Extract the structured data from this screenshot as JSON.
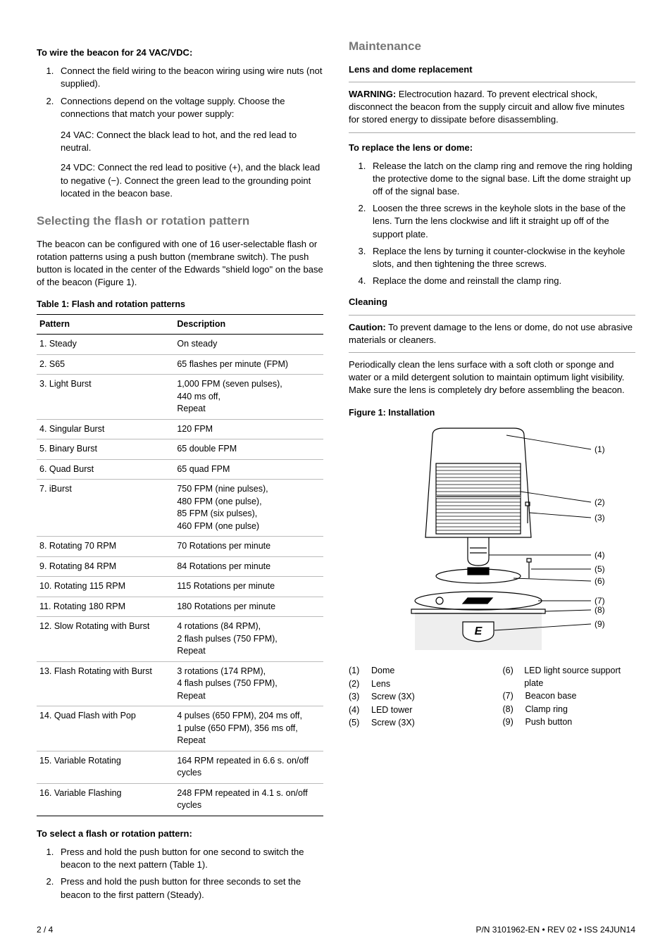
{
  "left": {
    "wire_heading": "To wire the beacon for 24 VAC/VDC:",
    "wire_steps": [
      "Connect the field wiring to the beacon wiring using wire nuts (not supplied).",
      "Connections depend on the voltage supply. Choose the connections that match your power supply:"
    ],
    "wire_sub1": "24 VAC: Connect the black lead to hot, and the red lead to neutral.",
    "wire_sub2": "24 VDC: Connect the red lead to positive (+), and the black lead to negative (−). Connect the green lead to the grounding point located in the beacon base.",
    "select_heading": "Selecting the flash or rotation pattern",
    "select_para": "The beacon can be configured with one of 16 user-selectable flash or rotation patterns using a push button (membrane switch). The push button is located in the center of the Edwards \"shield logo\" on the base of the beacon (Figure 1).",
    "table_caption": "Table 1: Flash and rotation patterns",
    "table_h1": "Pattern",
    "table_h2": "Description",
    "table_rows": [
      {
        "p": "1. Steady",
        "d": "On steady"
      },
      {
        "p": "2. S65",
        "d": "65 flashes per minute (FPM)"
      },
      {
        "p": "3. Light Burst",
        "d": "1,000 FPM (seven pulses),\n440 ms off,\nRepeat"
      },
      {
        "p": "4. Singular Burst",
        "d": "120 FPM"
      },
      {
        "p": "5. Binary Burst",
        "d": "65 double FPM"
      },
      {
        "p": "6. Quad Burst",
        "d": "65 quad FPM"
      },
      {
        "p": "7. iBurst",
        "d": "750 FPM (nine pulses),\n480 FPM (one pulse),\n85 FPM (six pulses),\n460 FPM (one pulse)"
      },
      {
        "p": "8. Rotating 70 RPM",
        "d": "70 Rotations per minute"
      },
      {
        "p": "9. Rotating 84 RPM",
        "d": "84 Rotations per minute"
      },
      {
        "p": "10. Rotating 115 RPM",
        "d": "115 Rotations per minute"
      },
      {
        "p": "11. Rotating 180 RPM",
        "d": "180 Rotations per minute"
      },
      {
        "p": "12. Slow Rotating with Burst",
        "d": "4 rotations (84 RPM),\n2 flash pulses (750 FPM),\nRepeat"
      },
      {
        "p": "13. Flash Rotating with Burst",
        "d": "3 rotations (174 RPM),\n4 flash pulses (750 FPM),\nRepeat"
      },
      {
        "p": "14. Quad Flash with Pop",
        "d": "4 pulses (650 FPM), 204 ms off,\n1 pulse (650 FPM), 356 ms off,\nRepeat"
      },
      {
        "p": "15. Variable Rotating",
        "d": "164 RPM repeated in 6.6 s. on/off cycles"
      },
      {
        "p": "16. Variable Flashing",
        "d": "248 FPM repeated in 4.1 s. on/off cycles"
      }
    ],
    "select_sub": "To select a flash or rotation pattern:",
    "select_steps": [
      "Press and hold the push button for one second to switch the beacon to the next pattern (Table 1).",
      "Press and hold the push button for three seconds to set the beacon to the first pattern (Steady)."
    ]
  },
  "right": {
    "maint_heading": "Maintenance",
    "lens_sub": "Lens and dome replacement",
    "warning_label": "WARNING:",
    "warning_text": " Electrocution hazard. To prevent electrical shock, disconnect the beacon from the supply circuit and allow five minutes for stored energy to dissipate before disassembling.",
    "replace_sub": "To replace the lens or dome:",
    "replace_steps": [
      "Release the latch on the clamp ring and remove the ring holding the protective dome to the signal base. Lift the dome straight up off of the signal base.",
      "Loosen the three screws in the keyhole slots in the base of the lens. Turn the lens clockwise and lift it straight up off of the support plate.",
      "Replace the lens by turning it counter-clockwise in the keyhole slots, and then tightening the three screws.",
      "Replace the dome and reinstall the clamp ring."
    ],
    "cleaning_sub": "Cleaning",
    "caution_label": "Caution:",
    "caution_text": " To prevent damage to the lens or dome, do not use abrasive materials or cleaners.",
    "cleaning_para": "Periodically clean the lens surface with a soft cloth or sponge and water or a mild detergent solution to maintain optimum light visibility. Make sure the lens is completely dry before assembling the beacon.",
    "figure_caption": "Figure 1: Installation",
    "legend_left": [
      {
        "n": "(1)",
        "t": "Dome"
      },
      {
        "n": "(2)",
        "t": "Lens"
      },
      {
        "n": "(3)",
        "t": "Screw (3X)"
      },
      {
        "n": "(4)",
        "t": "LED tower"
      },
      {
        "n": "(5)",
        "t": "Screw (3X)"
      }
    ],
    "legend_right": [
      {
        "n": "(6)",
        "t": "LED light source support plate"
      },
      {
        "n": "(7)",
        "t": "Beacon base"
      },
      {
        "n": "(8)",
        "t": "Clamp ring"
      },
      {
        "n": "(9)",
        "t": "Push button"
      }
    ],
    "callouts": [
      "(1)",
      "(2)",
      "(3)",
      "(4)",
      "(5)",
      "(6)",
      "(7)",
      "(8)",
      "(9)"
    ]
  },
  "footer": {
    "left": "2 / 4",
    "right": "P/N 3101962-EN • REV 02 • ISS 24JUN14"
  }
}
